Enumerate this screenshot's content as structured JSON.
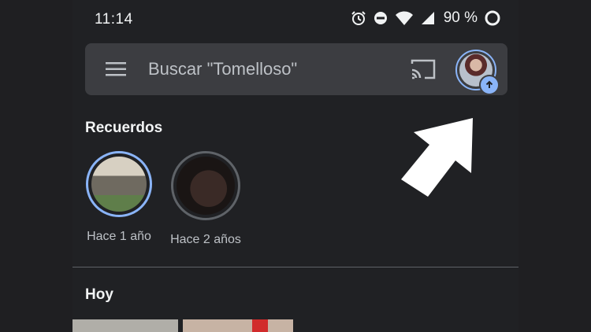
{
  "status_bar": {
    "time": "11:14",
    "battery": "90 %",
    "icons": [
      "alarm-icon",
      "do-not-disturb-icon",
      "wifi-icon",
      "signal-icon",
      "battery-icon"
    ]
  },
  "search": {
    "menu_icon": "menu-icon",
    "placeholder": "Buscar \"Tomelloso\"",
    "cast_icon": "cast-icon",
    "account_icon": "account-avatar",
    "upload_icon": "upload-arrow-icon"
  },
  "memories": {
    "title": "Recuerdos",
    "items": [
      {
        "label": "Hace 1 año"
      },
      {
        "label": "Hace 2 años"
      }
    ]
  },
  "today": {
    "title": "Hoy"
  },
  "colors": {
    "background": "#202124",
    "searchbar": "#3c3d41",
    "accent": "#8ab4f8"
  }
}
